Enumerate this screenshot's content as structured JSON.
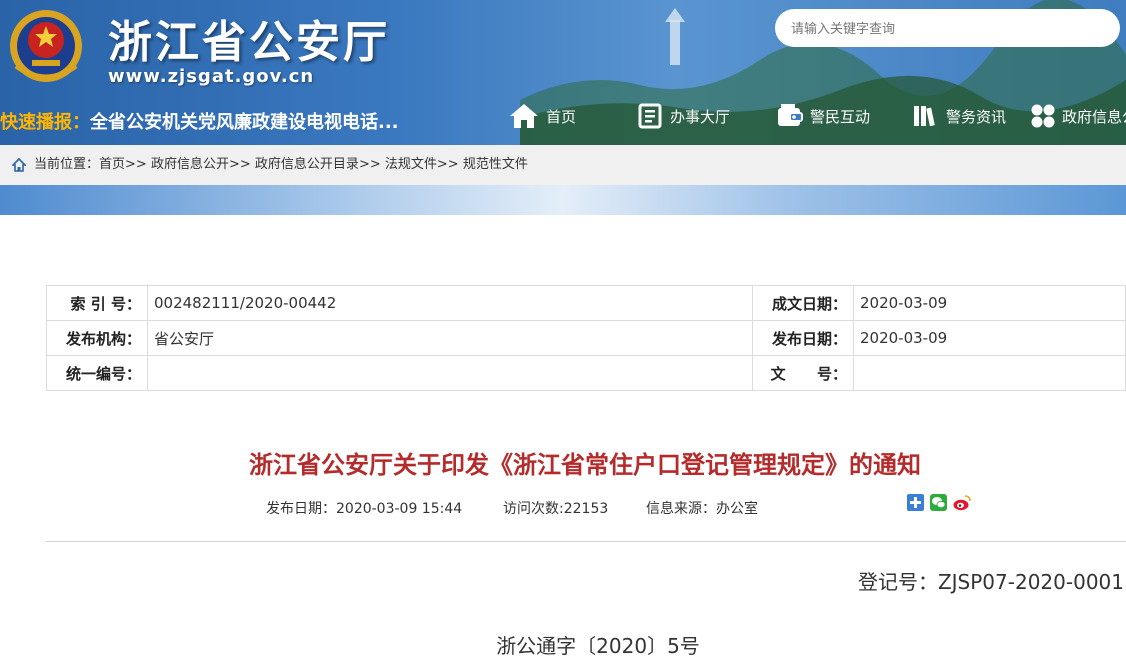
{
  "header": {
    "site_title": "浙江省公安厅",
    "site_url": "www.zjsgat.gov.cn",
    "search_placeholder": "请输入关键字查询",
    "ticker_label": "快速播报：",
    "ticker_text": "全省公安机关党风廉政建设电视电话..."
  },
  "nav": [
    {
      "label": "首页",
      "icon": "home-icon"
    },
    {
      "label": "办事大厅",
      "icon": "document-icon"
    },
    {
      "label": "警民互动",
      "icon": "wallet-icon"
    },
    {
      "label": "警务资讯",
      "icon": "books-icon"
    },
    {
      "label": "政府信息公",
      "icon": "grid-icon"
    }
  ],
  "breadcrumb": {
    "prefix": "当前位置：",
    "items": [
      "首页",
      "政府信息公开",
      "政府信息公开目录",
      "法规文件",
      "规范性文件"
    ],
    "separator": ">>"
  },
  "info_table": {
    "rows": [
      {
        "k1": "索 引 号：",
        "v1": "002482111/2020-00442",
        "k2": "成文日期：",
        "v2": "2020-03-09"
      },
      {
        "k1": "发布机构：",
        "v1": "省公安厅",
        "k2": "发布日期：",
        "v2": "2020-03-09"
      },
      {
        "k1": "统一编号：",
        "v1": "",
        "k2": "文      号：",
        "v2": ""
      }
    ]
  },
  "article": {
    "title": "浙江省公安厅关于印发《浙江省常住户口登记管理规定》的通知",
    "publish_time": "发布日期：2020-03-09 15:44",
    "visits": "访问次数:22153",
    "source": "信息来源：办公室",
    "reg_no": "登记号：ZJSP07-2020-0001",
    "doc_no": "浙公通字〔2020〕5号"
  },
  "share": [
    "share-plus-icon",
    "wechat-icon",
    "weibo-icon"
  ],
  "colors": {
    "header_blue": "#2a63a8",
    "title_red": "#b42b2b",
    "ticker_label": "#ffb400"
  }
}
